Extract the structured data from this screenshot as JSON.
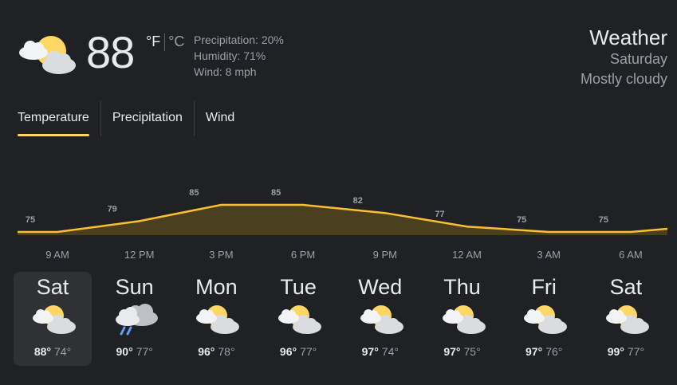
{
  "current": {
    "temp": "88",
    "unit_f": "°F",
    "unit_c": "°C",
    "icon": "mostly-cloudy-icon",
    "precipitation": "Precipitation: 20%",
    "humidity": "Humidity: 71%",
    "wind": "Wind: 8 mph"
  },
  "header": {
    "title": "Weather",
    "day": "Saturday",
    "condition": "Mostly cloudy"
  },
  "tabs": [
    {
      "label": "Temperature",
      "active": true
    },
    {
      "label": "Precipitation",
      "active": false
    },
    {
      "label": "Wind",
      "active": false
    }
  ],
  "colors": {
    "background": "#202124",
    "accent": "#fdd663",
    "chart_line": "#fbc02d",
    "chart_fill": "#4a3f1e",
    "selected_day": "#303134"
  },
  "chart_data": {
    "type": "area",
    "x": [
      "9 AM",
      "12 PM",
      "3 PM",
      "6 PM",
      "9 PM",
      "12 AM",
      "3 AM",
      "6 AM"
    ],
    "values": [
      75,
      79,
      85,
      85,
      82,
      77,
      75,
      75
    ],
    "labels": [
      "75",
      "79",
      "85",
      "85",
      "82",
      "77",
      "75",
      "75"
    ]
  },
  "days": [
    {
      "name": "Sat",
      "hi": "88°",
      "lo": "74°",
      "icon": "partly-cloudy-icon",
      "selected": true
    },
    {
      "name": "Sun",
      "hi": "90°",
      "lo": "77°",
      "icon": "rain-cloud-icon",
      "selected": false
    },
    {
      "name": "Mon",
      "hi": "96°",
      "lo": "78°",
      "icon": "partly-cloudy-icon",
      "selected": false
    },
    {
      "name": "Tue",
      "hi": "96°",
      "lo": "77°",
      "icon": "partly-cloudy-icon",
      "selected": false
    },
    {
      "name": "Wed",
      "hi": "97°",
      "lo": "74°",
      "icon": "partly-cloudy-icon",
      "selected": false
    },
    {
      "name": "Thu",
      "hi": "97°",
      "lo": "75°",
      "icon": "partly-cloudy-icon",
      "selected": false
    },
    {
      "name": "Fri",
      "hi": "97°",
      "lo": "76°",
      "icon": "partly-cloudy-icon",
      "selected": false
    },
    {
      "name": "Sat",
      "hi": "99°",
      "lo": "77°",
      "icon": "partly-cloudy-icon",
      "selected": false
    }
  ]
}
